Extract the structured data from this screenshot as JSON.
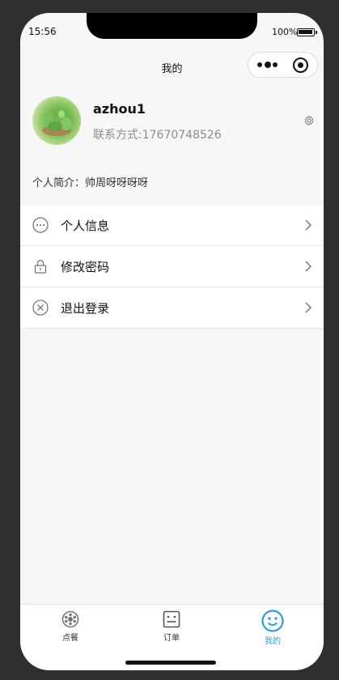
{
  "status_bar": {
    "time": "15:56",
    "battery": "100%"
  },
  "nav": {
    "title": "我的"
  },
  "profile": {
    "username": "azhou1",
    "contact": "联系方式:17670748526",
    "bio": "个人简介：帅周呀呀呀呀"
  },
  "menu": {
    "items": [
      {
        "label": "个人信息",
        "icon": "more-circle-icon"
      },
      {
        "label": "修改密码",
        "icon": "lock-icon"
      },
      {
        "label": "退出登录",
        "icon": "close-circle-icon"
      }
    ]
  },
  "tabbar": {
    "tabs": [
      {
        "label": "点餐",
        "icon": "food-icon",
        "active": false
      },
      {
        "label": "订单",
        "icon": "order-icon",
        "active": false
      },
      {
        "label": "我的",
        "icon": "smile-icon",
        "active": true
      }
    ],
    "active_color": "#2aa1dc"
  }
}
